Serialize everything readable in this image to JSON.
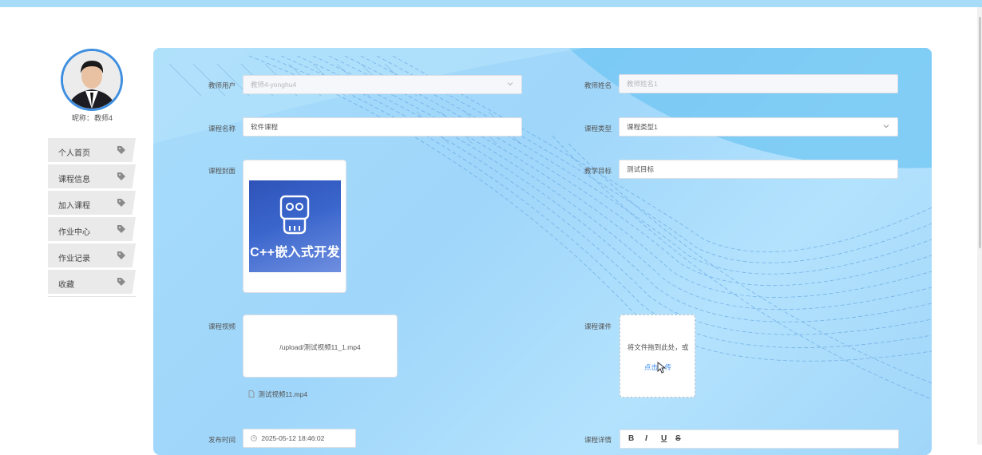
{
  "profile": {
    "nickname_label": "昵称：",
    "nickname_value": "教师4"
  },
  "menu": [
    {
      "label": "个人首页",
      "icon": "tag-icon"
    },
    {
      "label": "课程信息",
      "icon": "tag-icon"
    },
    {
      "label": "加入课程",
      "icon": "tag-icon"
    },
    {
      "label": "作业中心",
      "icon": "tag-icon"
    },
    {
      "label": "作业记录",
      "icon": "tag-icon"
    },
    {
      "label": "收藏",
      "icon": "tag-icon"
    }
  ],
  "form": {
    "teacher_user": {
      "label": "教师用户",
      "value": "教师4-yonghu4"
    },
    "teacher_name": {
      "label": "教师姓名",
      "placeholder": "教师姓名1"
    },
    "course_name": {
      "label": "课程名称",
      "value": "软件课程"
    },
    "course_type": {
      "label": "课程类型",
      "value": "课程类型1"
    },
    "course_cover": {
      "label": "课程封面",
      "image_text": "C++嵌入式开发"
    },
    "teaching_goal": {
      "label": "教学目标",
      "value": "测试目标"
    },
    "course_video": {
      "label": "课程视频",
      "path": "/upload/测试视频11_1.mp4",
      "file_name": "测试视频11.mp4"
    },
    "course_ware": {
      "label": "课程课件",
      "drop_text": "将文件拖到此处，或",
      "upload_link": "点击上传"
    },
    "publish_time": {
      "label": "发布时间",
      "value": "2025-05-12 18:46:02"
    },
    "course_detail": {
      "label": "课程详情"
    }
  },
  "editor_toolbar": [
    "B",
    "I",
    "U",
    "S"
  ],
  "colors": {
    "accent": "#3f8fe0",
    "link": "#3e8ef0",
    "topbar": "#a6dcf7",
    "panel": "#a7dcfb"
  }
}
